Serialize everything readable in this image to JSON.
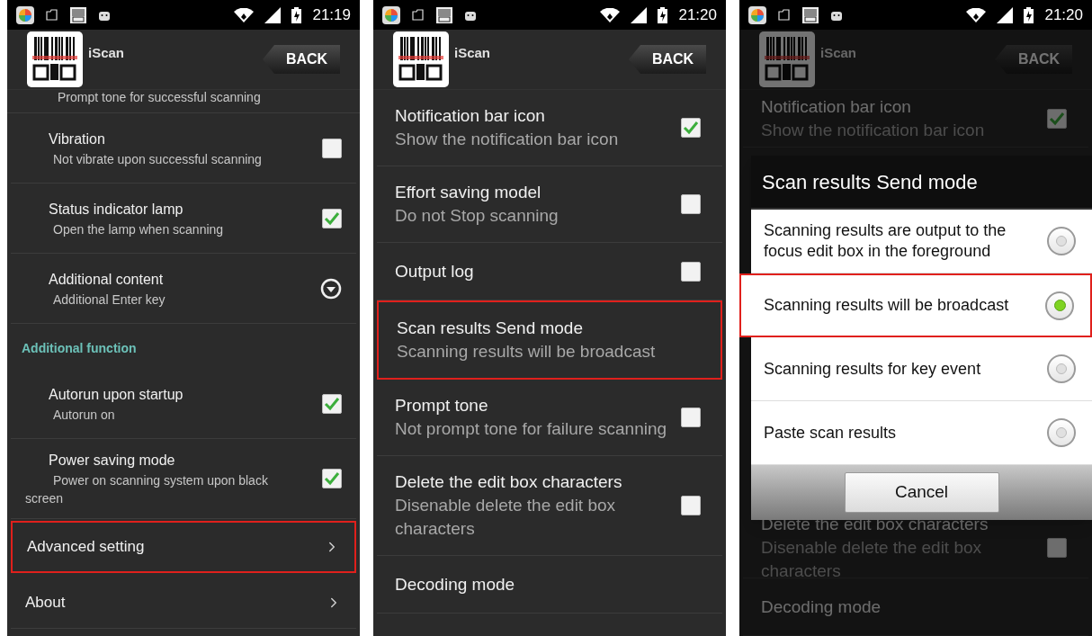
{
  "panels": [
    {
      "kind": "compact",
      "status_time": "21:19",
      "app_title": "iScan",
      "back_label": "BACK",
      "rows": [
        {
          "kind": "partial",
          "subtitle": "Prompt tone for successful scanning"
        },
        {
          "kind": "checkbox",
          "title": "Vibration",
          "subtitle": "Not vibrate upon successful scanning",
          "checked": false,
          "highlighted": false
        },
        {
          "kind": "checkbox",
          "title": "Status indicator lamp",
          "subtitle": "Open the lamp when scanning",
          "checked": true,
          "highlighted": false
        },
        {
          "kind": "dropdown",
          "title": "Additional content",
          "subtitle": "Additional Enter key",
          "highlighted": false
        },
        {
          "kind": "category",
          "title": "Additional function"
        },
        {
          "kind": "checkbox",
          "title": "Autorun upon startup",
          "subtitle": "Autorun on",
          "checked": true,
          "highlighted": false
        },
        {
          "kind": "checkbox",
          "title": "Power saving mode",
          "subtitle": "Power on scanning system upon black screen",
          "checked": true,
          "highlighted": false
        },
        {
          "kind": "link",
          "title": "Advanced setting",
          "highlighted": true
        },
        {
          "kind": "link",
          "title": "About",
          "highlighted": false
        }
      ]
    },
    {
      "kind": "regular",
      "status_time": "21:20",
      "app_title": "iScan",
      "back_label": "BACK",
      "rows": [
        {
          "kind": "checkbox",
          "title": "Notification bar icon",
          "subtitle": "Show the notification bar icon",
          "checked": true,
          "highlighted": false
        },
        {
          "kind": "checkbox",
          "title": "Effort saving model",
          "subtitle": "Do not Stop scanning",
          "checked": false,
          "highlighted": false
        },
        {
          "kind": "checkbox",
          "title": "Output log",
          "checked": false,
          "highlighted": false
        },
        {
          "kind": "value",
          "title": "Scan results Send mode",
          "subtitle": "Scanning results will be broadcast",
          "highlighted": true
        },
        {
          "kind": "checkbox",
          "title": "Prompt tone",
          "subtitle": "Not prompt tone for failure scanning",
          "checked": false,
          "highlighted": false
        },
        {
          "kind": "checkbox",
          "title": "Delete the edit box characters",
          "subtitle": "Disenable delete the edit box characters",
          "checked": false,
          "highlighted": false
        },
        {
          "kind": "value",
          "title": "Decoding mode",
          "highlighted": false
        }
      ]
    },
    {
      "kind": "dialog",
      "status_time": "21:20",
      "app_title": "iScan",
      "back_label": "BACK",
      "rows": [
        {
          "kind": "checkbox",
          "title": "Notification bar icon",
          "subtitle": "Show the notification bar icon",
          "checked": true,
          "highlighted": false
        },
        {
          "kind": "checkbox",
          "title": "Delete the edit box characters",
          "subtitle": "Disenable delete the edit box characters",
          "checked": false,
          "highlighted": false
        },
        {
          "kind": "value",
          "title": "Decoding mode",
          "highlighted": false
        }
      ],
      "dialog": {
        "title": "Scan results Send mode",
        "cancel_label": "Cancel",
        "options": [
          {
            "label": "Scanning results are output to the focus edit box in the foreground",
            "selected": false,
            "highlighted": false
          },
          {
            "label": "Scanning results will be broadcast",
            "selected": true,
            "highlighted": true
          },
          {
            "label": "Scanning results for key event",
            "selected": false,
            "highlighted": false
          },
          {
            "label": "Paste scan results",
            "selected": false,
            "highlighted": false
          }
        ]
      }
    }
  ]
}
